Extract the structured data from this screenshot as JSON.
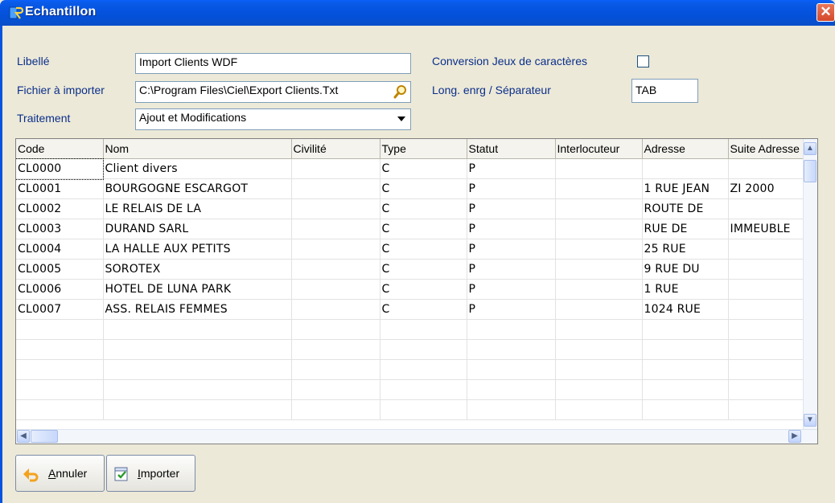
{
  "window": {
    "title": "Echantillon",
    "close_glyph": "✕"
  },
  "form": {
    "libelle": {
      "label": "Libellé",
      "value": "Import Clients WDF"
    },
    "fichier": {
      "label": "Fichier à importer",
      "value": "C:\\Program Files\\Ciel\\Export Clients.Txt"
    },
    "traitement": {
      "label": "Traitement",
      "value": "Ajout et Modifications"
    },
    "conversion": {
      "label": "Conversion Jeux de caractères",
      "checked": false
    },
    "long_enrg": {
      "label": "Long. enrg / Séparateur",
      "value": "TAB"
    }
  },
  "grid": {
    "columns": [
      "Code",
      "Nom",
      "Civilité",
      "Type",
      "Statut",
      "Interlocuteur",
      "Adresse",
      "Suite Adresse"
    ],
    "rows": [
      [
        "CL0000",
        "Client divers",
        "",
        "C",
        "P",
        "",
        "",
        ""
      ],
      [
        "CL0001",
        "BOURGOGNE ESCARGOT",
        "",
        "C",
        "P",
        "",
        "1 RUE JEAN",
        "ZI 2000"
      ],
      [
        "CL0002",
        "LE RELAIS DE LA",
        "",
        "C",
        "P",
        "",
        "ROUTE DE",
        ""
      ],
      [
        "CL0003",
        "DURAND SARL",
        "",
        "C",
        "P",
        "",
        "RUE DE",
        "IMMEUBLE"
      ],
      [
        "CL0004",
        "LA HALLE AUX PETITS",
        "",
        "C",
        "P",
        "",
        "25 RUE",
        ""
      ],
      [
        "CL0005",
        "SOROTEX",
        "",
        "C",
        "P",
        "",
        "9 RUE DU",
        ""
      ],
      [
        "CL0006",
        "HOTEL DE LUNA PARK",
        "",
        "C",
        "P",
        "",
        "1 RUE",
        ""
      ],
      [
        "CL0007",
        "ASS. RELAIS FEMMES",
        "",
        "C",
        "P",
        "",
        "1024 RUE",
        ""
      ],
      [
        "",
        "",
        "",
        "",
        "",
        "",
        "",
        ""
      ],
      [
        "",
        "",
        "",
        "",
        "",
        "",
        "",
        ""
      ],
      [
        "",
        "",
        "",
        "",
        "",
        "",
        "",
        ""
      ],
      [
        "",
        "",
        "",
        "",
        "",
        "",
        "",
        ""
      ],
      [
        "",
        "",
        "",
        "",
        "",
        "",
        "",
        ""
      ]
    ]
  },
  "buttons": {
    "annuler": {
      "label_first": "A",
      "label_rest": "nnuler",
      "icon": "undo-arrow-icon"
    },
    "importer": {
      "label_first": "I",
      "label_rest": "mporter",
      "icon": "import-check-icon"
    }
  },
  "colors": {
    "titlebar": "#0553e0",
    "label_text": "#0b2f8a",
    "close": "#d4492a",
    "dialog_bg": "#ece9d8"
  }
}
